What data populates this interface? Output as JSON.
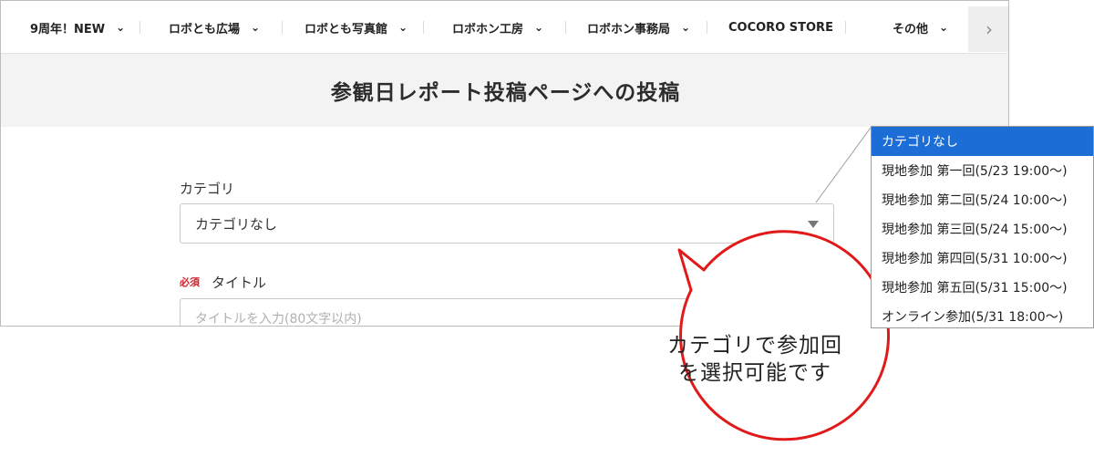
{
  "nav": {
    "items": [
      {
        "label": "9周年！NEW",
        "dropdown": true
      },
      {
        "label": "ロボとも広場",
        "dropdown": true
      },
      {
        "label": "ロボとも写真館",
        "dropdown": true
      },
      {
        "label": "ロボホン工房",
        "dropdown": true
      },
      {
        "label": "ロボホン事務局",
        "dropdown": true
      },
      {
        "label": "COCORO STORE",
        "dropdown": false
      },
      {
        "label": "その他",
        "dropdown": true
      }
    ]
  },
  "page": {
    "title": "参観日レポート投稿ページへの投稿"
  },
  "form": {
    "category_label": "カテゴリ",
    "category_value": "カテゴリなし",
    "required_badge": "必須",
    "title_label": "タイトル",
    "title_placeholder": "タイトルを入力(80文字以内)"
  },
  "dropdown": {
    "options": [
      "カテゴリなし",
      "現地参加 第一回(5/23 19:00～)",
      "現地参加 第二回(5/24 10:00～)",
      "現地参加 第三回(5/24 15:00～)",
      "現地参加 第四回(5/31 10:00～)",
      "現地参加 第五回(5/31 15:00～)",
      "オンライン参加(5/31 18:00～)"
    ],
    "selected_index": 0
  },
  "callout": {
    "line1": "カテゴリで参加回",
    "line2": "を選択可能です"
  },
  "colors": {
    "accent_select": "#1c6ed6",
    "callout_border": "#e01a1a",
    "required": "#d0232b"
  }
}
